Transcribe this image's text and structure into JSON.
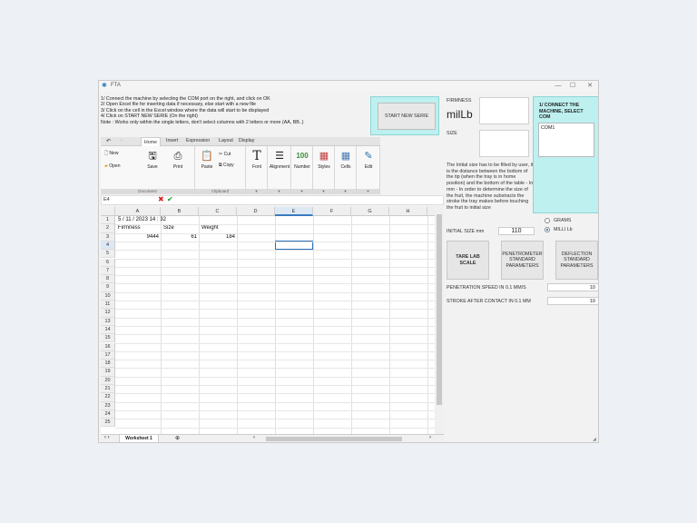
{
  "window": {
    "title": "FTA",
    "icon": "fta-app-icon",
    "controls": [
      "minimize",
      "maximize",
      "close"
    ]
  },
  "instructions": [
    "1/ Connect the machine by selecting the COM port on the right, and click on OK",
    "2/ Open Excel file for inserting data if necessary, else start with a new file",
    "3/ Click on the cell in the Excel window where the data will start to be displayed",
    "4/ Click on START NEW SERIE (On the right)",
    "Note : Works only within the single letters, don't select columns with 2 letters or more (AA, BB..)"
  ],
  "start_button": "START NEW SERIE",
  "ribbon": {
    "tabs": [
      "Home",
      "Insert",
      "Expression",
      "Layout",
      "Display"
    ],
    "active_tab": "Home",
    "new": "New",
    "open": "Open",
    "save": "Save",
    "print": "Print",
    "paste": "Paste",
    "cut": "Cut",
    "copy": "Copy",
    "font": "Font",
    "alignment": "Alignment",
    "number": "Number",
    "styles": "Styles",
    "cells": "Cells",
    "edit": "Edit",
    "group_document": "Document",
    "group_clipboard": "Clipboard"
  },
  "formula_bar": {
    "cell_ref": "E4"
  },
  "sheet": {
    "columns": [
      "A",
      "B",
      "C",
      "D",
      "E",
      "F",
      "G",
      "H"
    ],
    "rows": [
      "1",
      "2",
      "3",
      "4",
      "5",
      "6",
      "7",
      "8",
      "9",
      "10",
      "11",
      "12",
      "13",
      "14",
      "15",
      "16",
      "17",
      "18",
      "19",
      "20",
      "21",
      "22",
      "23",
      "24",
      "25"
    ],
    "r1_date": "5 / 11 / 2023  14 : 32",
    "r2_a": "Firmness",
    "r2_b": "Size",
    "r2_c": "Weight",
    "r3_a": "9444",
    "r3_b": "61",
    "r3_c": "184",
    "selected_cell": "E4",
    "tab": "Worksheet 1"
  },
  "right_panel": {
    "firmness_label": "FIRMNESS",
    "firmness_unit": "milLb",
    "size_label": "SIZE",
    "info": "The Initial size has to be filled by user, it is the distance between the bottom of the tip (when the tray is in home position) and the bottom of the table - In mm - In order to determine the size of the fruit, the machine substracts the stroke the tray makes before touching the fruit to initial size",
    "initial_size_label": "INITIAL SIZE mm",
    "initial_size_value": "110",
    "com_title": "1/ CONNECT THE MACHINE, SELECT COM",
    "com_items": [
      "COM1"
    ],
    "units": [
      {
        "label": "GRAMS",
        "selected": false
      },
      {
        "label": "MILLI Lb",
        "selected": true
      }
    ],
    "tare_button": "TARE LAB SCALE",
    "penetrometer_button": "PENETROMETER STANDARD PARAMETERS",
    "deflection_button": "DEFLECTION STANDARD PARAMETERS",
    "speed_label": "PENETRATION SPEED IN 0.1 MM/S",
    "speed_value": "10",
    "stroke_label": "STROKE AFTER CONTACT IN 0.1 MM",
    "stroke_value": "10"
  }
}
